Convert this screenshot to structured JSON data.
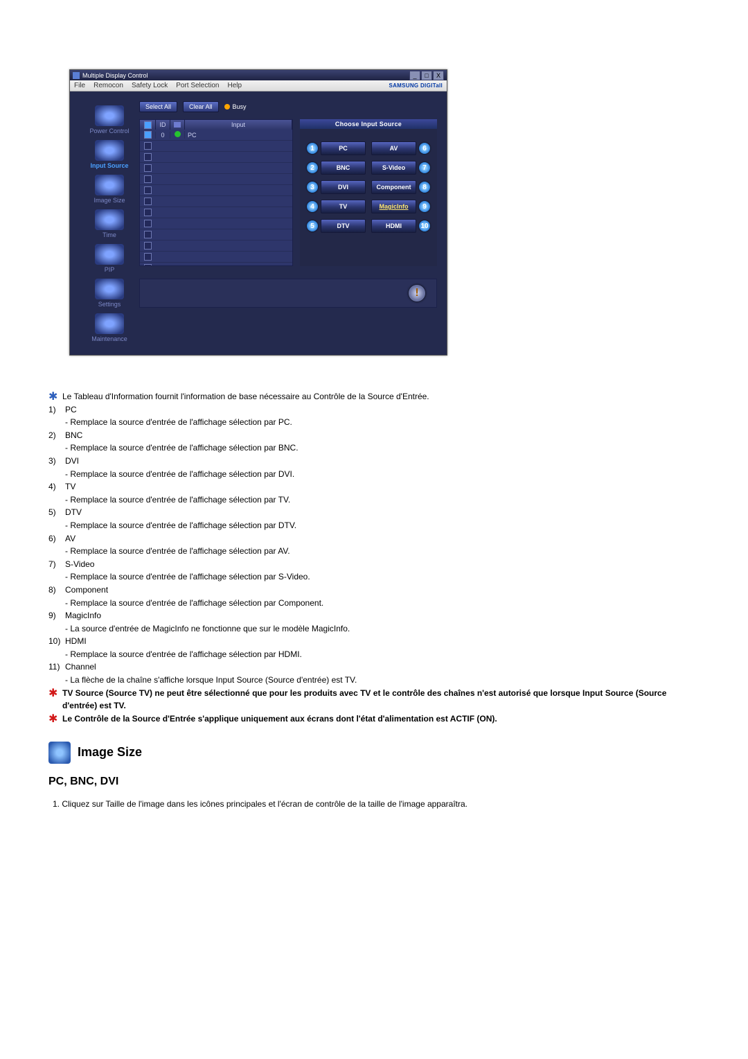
{
  "app": {
    "title": "Multiple Display Control",
    "menu": [
      "File",
      "Remocon",
      "Safety Lock",
      "Port Selection",
      "Help"
    ],
    "brand": "SAMSUNG DIGITall"
  },
  "sidebar": {
    "items": [
      {
        "label": "Power Control"
      },
      {
        "label": "Input Source",
        "active": true
      },
      {
        "label": "Image Size"
      },
      {
        "label": "Time"
      },
      {
        "label": "PIP"
      },
      {
        "label": "Settings"
      },
      {
        "label": "Maintenance"
      }
    ]
  },
  "toolbar": {
    "select_all": "Select All",
    "clear_all": "Clear All",
    "busy": "Busy"
  },
  "list": {
    "headers": {
      "id": "ID",
      "input": "Input"
    },
    "first_row": {
      "id": "0",
      "input": "PC"
    },
    "row_count": 13
  },
  "panel": {
    "header": "Choose Input Source",
    "sources": [
      {
        "n": "1",
        "label": "PC"
      },
      {
        "n": "6",
        "label": "AV"
      },
      {
        "n": "2",
        "label": "BNC"
      },
      {
        "n": "7",
        "label": "S-Video"
      },
      {
        "n": "3",
        "label": "DVI"
      },
      {
        "n": "8",
        "label": "Component"
      },
      {
        "n": "4",
        "label": "TV"
      },
      {
        "n": "9",
        "label": "MagicInfo",
        "yellow": true
      },
      {
        "n": "5",
        "label": "DTV"
      },
      {
        "n": "10",
        "label": "HDMI"
      }
    ]
  },
  "notes": {
    "intro": "Le Tableau d'Information fournit l'information de base nécessaire au Contrôle de la Source d'Entrée.",
    "items": [
      {
        "n": "1)",
        "title": "PC",
        "desc": "- Remplace la source d'entrée de l'affichage sélection par PC."
      },
      {
        "n": "2)",
        "title": "BNC",
        "desc": "- Remplace la source d'entrée de l'affichage sélection par BNC."
      },
      {
        "n": "3)",
        "title": "DVI",
        "desc": "- Remplace la source d'entrée de l'affichage sélection par DVI."
      },
      {
        "n": "4)",
        "title": "TV",
        "desc": "- Remplace la source d'entrée de l'affichage sélection par TV."
      },
      {
        "n": "5)",
        "title": "DTV",
        "desc": "- Remplace la source d'entrée de l'affichage sélection par DTV."
      },
      {
        "n": "6)",
        "title": "AV",
        "desc": "- Remplace la source d'entrée de l'affichage sélection par AV."
      },
      {
        "n": "7)",
        "title": "S-Video",
        "desc": "- Remplace la source d'entrée de l'affichage sélection par S-Video."
      },
      {
        "n": "8)",
        "title": "Component",
        "desc": "- Remplace la source d'entrée de l'affichage sélection par Component."
      },
      {
        "n": "9)",
        "title": "MagicInfo",
        "desc": "- La source d'entrée de MagicInfo ne fonctionne que sur le modèle MagicInfo."
      },
      {
        "n": "10)",
        "title": "HDMI",
        "desc": "- Remplace la source d'entrée de l'affichage sélection par HDMI."
      },
      {
        "n": "11)",
        "title": "Channel",
        "desc": "- La flèche de la chaîne s'affiche lorsque Input Source (Source d'entrée) est TV."
      }
    ],
    "warn1": "TV Source (Source TV) ne peut être sélectionné que pour les produits avec TV et le contrôle des chaînes n'est autorisé que lorsque Input Source (Source d'entrée) est TV.",
    "warn2": "Le Contrôle de la Source d'Entrée s'applique uniquement aux écrans dont l'état d'alimentation est ACTIF (ON)."
  },
  "section": {
    "title": "Image Size",
    "subheading": "PC, BNC, DVI",
    "step": "1.  Cliquez sur Taille de l'image dans les icônes principales et l'écran de contrôle de la taille de l'image apparaîtra."
  }
}
